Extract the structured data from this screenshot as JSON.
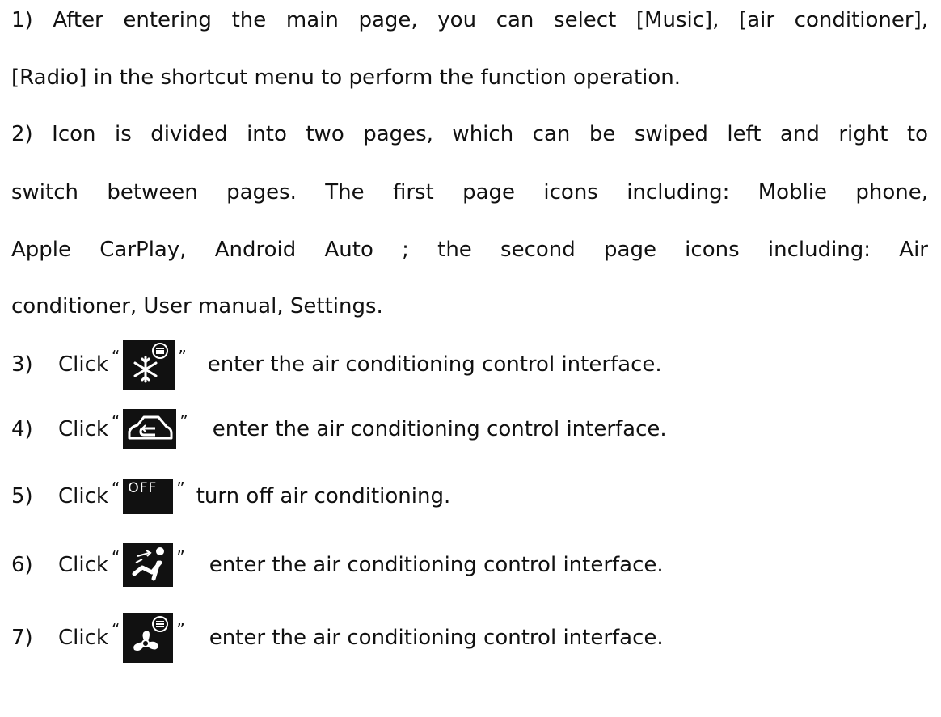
{
  "document": {
    "paragraphs": [
      {
        "id": "p1",
        "lines": [
          "1)  After entering the main page, you can select [Music], [air conditioner],",
          "[Radio] in the shortcut menu to perform the function operation."
        ]
      },
      {
        "id": "p2",
        "lines": [
          "2)  Icon is divided into two pages, which can be swiped left and right to",
          "switch between pages. The first page icons including: Moblie phone,",
          "Apple CarPlay, Android Auto ; the second page icons including: Air",
          "conditioner, User manual, Settings."
        ]
      }
    ],
    "steps": [
      {
        "num": "3)",
        "word": "Click",
        "open_quote": "“",
        "close_quote": "”",
        "icon": "snowflake-ac-icon",
        "text": "enter the air conditioning control interface."
      },
      {
        "num": "4)",
        "word": "Click",
        "open_quote": "“",
        "close_quote": "”",
        "icon": "car-air-recirculation-icon",
        "text": "enter the air conditioning control interface."
      },
      {
        "num": "5)",
        "word": "Click",
        "open_quote": "“",
        "close_quote": "”",
        "icon": "off-button-icon",
        "icon_label": "OFF",
        "text": "turn off air conditioning."
      },
      {
        "num": "6)",
        "word": "Click",
        "open_quote": "“",
        "close_quote": "”",
        "icon": "air-flow-direction-icon",
        "text": "enter the air conditioning control interface."
      },
      {
        "num": "7)",
        "word": "Click",
        "open_quote": "“",
        "close_quote": "”",
        "icon": "fan-speed-icon",
        "text": "enter the air conditioning control interface."
      }
    ],
    "colors": {
      "text": "#111111",
      "icon_background": "#111111",
      "icon_foreground": "#ffffff"
    }
  }
}
